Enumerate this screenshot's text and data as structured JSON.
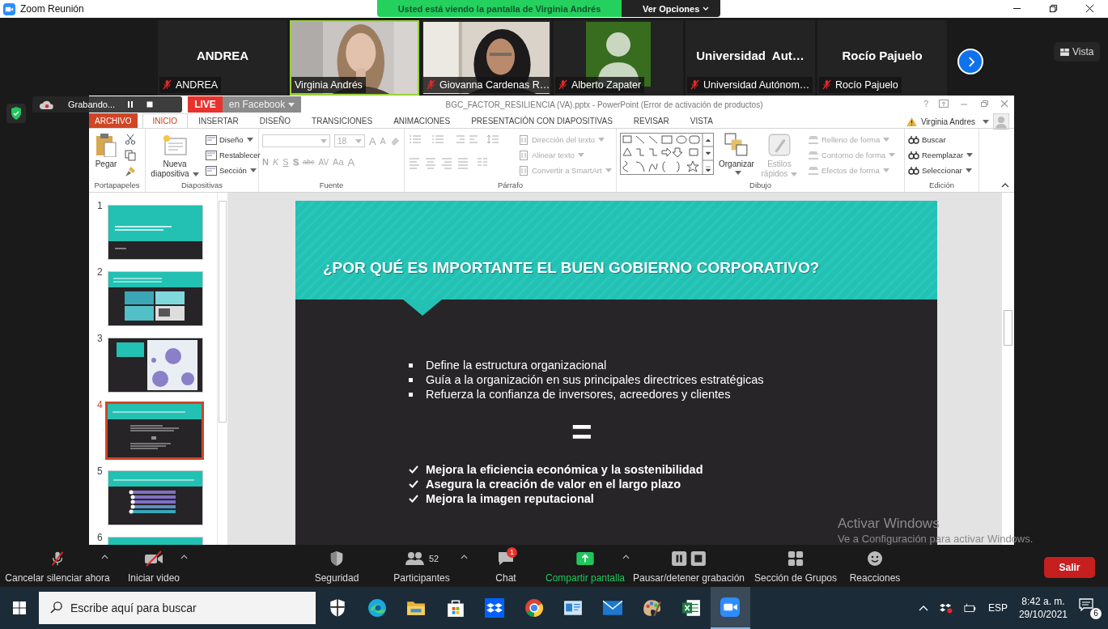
{
  "window": {
    "title": "Zoom Reunión"
  },
  "share_banner": {
    "text": "Usted está viendo la pantalla de Virginia Andrés",
    "options": "Ver Opciones"
  },
  "participants": [
    {
      "kind": "name",
      "name": "ANDREA",
      "label": "ANDREA",
      "muted": true,
      "speaking": false
    },
    {
      "kind": "video",
      "label": "Virginia Andrés",
      "muted": false,
      "speaking": true
    },
    {
      "kind": "video",
      "label": "Giovanna Cardenas R…",
      "muted": true,
      "speaking": false
    },
    {
      "kind": "avatar",
      "label": "Alberto Zapater",
      "muted": true,
      "speaking": false
    },
    {
      "kind": "name",
      "name": "Universidad  Aut…",
      "label": "Universidad Autónom…",
      "muted": true,
      "speaking": false
    },
    {
      "kind": "name",
      "name": "Rocío Pajuelo",
      "label": "Rocío Pajuelo",
      "muted": true,
      "speaking": false
    }
  ],
  "view_button": "Vista",
  "recording": {
    "label": "Grabando...",
    "live": "LIVE",
    "destination": "en Facebook"
  },
  "powerpoint": {
    "title": "BGC_FACTOR_RESILIENCIA (VA).pptx - PowerPoint (Error de activación de productos)",
    "help": "?",
    "user": "Virginia Andres",
    "tabs": [
      {
        "label": "ARCHIVO",
        "kind": "file",
        "selected": false
      },
      {
        "label": "INICIO",
        "kind": "tab",
        "selected": true
      },
      {
        "label": "INSERTAR",
        "kind": "tab",
        "selected": false
      },
      {
        "label": "DISEÑO",
        "kind": "tab",
        "selected": false
      },
      {
        "label": "TRANSICIONES",
        "kind": "tab",
        "selected": false
      },
      {
        "label": "ANIMACIONES",
        "kind": "tab",
        "selected": false
      },
      {
        "label": "PRESENTACIÓN CON DIAPOSITIVAS",
        "kind": "tab",
        "selected": false
      },
      {
        "label": "REVISAR",
        "kind": "tab",
        "selected": false
      },
      {
        "label": "VISTA",
        "kind": "tab",
        "selected": false
      }
    ],
    "ribbon": [
      {
        "kind": "clipboard",
        "label": "Portapapeles",
        "items": [
          {
            "label": "Pegar",
            "disabled": false,
            "menu": false
          }
        ]
      },
      {
        "kind": "slides",
        "label": "Diapositivas",
        "items": [
          {
            "label": "Nueva diapositiva",
            "disabled": false,
            "menu": true
          },
          {
            "label": "Diseño",
            "disabled": false,
            "menu": true
          },
          {
            "label": "Restablecer",
            "disabled": false,
            "menu": false
          },
          {
            "label": "Sección",
            "disabled": false,
            "menu": true
          }
        ]
      },
      {
        "kind": "font",
        "label": "Fuente",
        "size": "18",
        "items": [
          {
            "label": "A",
            "kind": "grow",
            "disabled": true
          },
          {
            "label": "A",
            "kind": "shrink",
            "disabled": true
          },
          {
            "label": "N",
            "kind": "bold",
            "disabled": true
          },
          {
            "label": "K",
            "kind": "italic",
            "disabled": true
          },
          {
            "label": "S",
            "kind": "underline",
            "disabled": true
          },
          {
            "label": "S",
            "kind": "shadow",
            "disabled": true
          },
          {
            "label": "abc",
            "kind": "strike",
            "disabled": true
          },
          {
            "label": "AV",
            "kind": "spacing",
            "disabled": true
          },
          {
            "label": "Aa",
            "kind": "case",
            "disabled": true
          },
          {
            "label": "A",
            "kind": "color",
            "disabled": true
          }
        ]
      },
      {
        "kind": "paragraph",
        "label": "Párrafo",
        "items": [
          {
            "label": "Dirección del texto",
            "disabled": true,
            "menu": true
          },
          {
            "label": "Alinear texto",
            "disabled": true,
            "menu": true
          },
          {
            "label": "Convertir a SmartArt",
            "disabled": true,
            "menu": true
          }
        ]
      },
      {
        "kind": "drawing",
        "label": "Dibujo",
        "items": [
          {
            "label": "Organizar",
            "disabled": false,
            "menu": true
          },
          {
            "label": "Estilos rápidos",
            "disabled": true,
            "menu": true
          },
          {
            "label": "Relleno de forma",
            "disabled": true,
            "menu": true
          },
          {
            "label": "Contorno de forma",
            "disabled": true,
            "menu": true
          },
          {
            "label": "Efectos de forma",
            "disabled": true,
            "menu": true
          }
        ]
      },
      {
        "kind": "editing",
        "label": "Edición",
        "items": [
          {
            "label": "Buscar",
            "disabled": false,
            "menu": false
          },
          {
            "label": "Reemplazar",
            "disabled": false,
            "menu": true
          },
          {
            "label": "Seleccionar",
            "disabled": false,
            "menu": true
          }
        ]
      }
    ],
    "thumbnails": [
      {
        "number": "1",
        "kind": "title",
        "selected": false
      },
      {
        "number": "2",
        "kind": "images",
        "selected": false
      },
      {
        "number": "3",
        "kind": "diagram",
        "selected": false
      },
      {
        "number": "4",
        "kind": "bullets",
        "selected": true
      },
      {
        "number": "5",
        "kind": "timeline",
        "selected": false
      },
      {
        "number": "6",
        "kind": "title",
        "selected": false
      }
    ],
    "slide": {
      "title": "¿POR QUÉ ES IMPORTANTE EL BUEN GOBIERNO CORPORATIVO?",
      "bullets": [
        "Define la estructura organizacional",
        "Guía a la organización en sus principales directrices estratégicas",
        "Refuerza la confianza de inversores, acreedores y clientes"
      ],
      "symbol": "=",
      "checks": [
        "Mejora la eficiencia económica y la sostenibilidad",
        "Asegura la creación de valor en el largo plazo",
        "Mejora la imagen reputacional"
      ]
    }
  },
  "activation": {
    "title": "Activar Windows",
    "text": "Ve a Configuración para activar Windows."
  },
  "toolbar": [
    {
      "kind": "mic",
      "label": "Cancelar silenciar ahora",
      "caret": true
    },
    {
      "kind": "video",
      "label": "Iniciar video",
      "caret": true
    },
    {
      "kind": "security",
      "label": "Seguridad",
      "caret": false
    },
    {
      "kind": "participants",
      "label": "Participantes",
      "count": "52",
      "caret": true
    },
    {
      "kind": "chat",
      "label": "Chat",
      "badge": "1",
      "caret": false
    },
    {
      "kind": "share",
      "label": "Compartir pantalla",
      "caret": true
    },
    {
      "kind": "record",
      "label": "Pausar/detener grabación",
      "caret": false
    },
    {
      "kind": "groups",
      "label": "Sección de Grupos",
      "caret": false
    },
    {
      "kind": "reactions",
      "label": "Reacciones",
      "caret": false
    }
  ],
  "leave": "Salir",
  "taskbar": {
    "search": {
      "placeholder": "Escribe aquí para buscar"
    },
    "apps": [
      {
        "kind": "shield",
        "selected": false
      },
      {
        "kind": "swirl",
        "selected": false
      },
      {
        "kind": "folder",
        "selected": false
      },
      {
        "kind": "bag",
        "selected": false
      },
      {
        "kind": "box",
        "selected": false
      },
      {
        "kind": "ring",
        "selected": false
      },
      {
        "kind": "card",
        "selected": false
      },
      {
        "kind": "mail",
        "selected": false
      },
      {
        "kind": "palette",
        "selected": false
      },
      {
        "kind": "sheet",
        "selected": false
      },
      {
        "kind": "camera",
        "selected": true
      }
    ],
    "language": "ESP",
    "time": "8:42 a. m.",
    "date": "29/10/2021",
    "notifications": "6"
  }
}
